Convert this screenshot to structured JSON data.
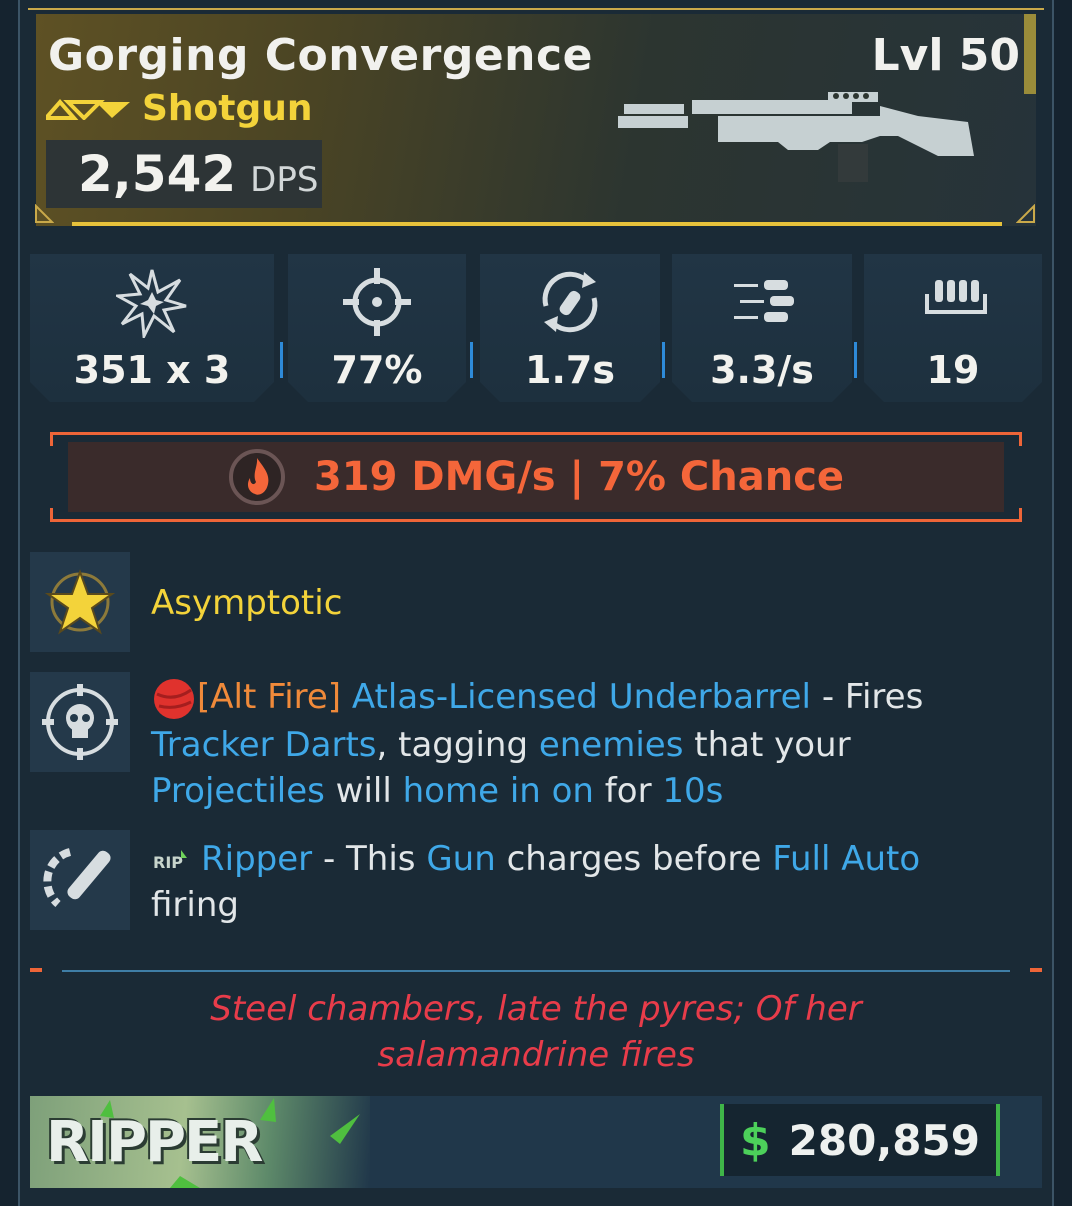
{
  "item": {
    "name": "Gorging Convergence",
    "level": "Lvl 50",
    "type": "Shotgun",
    "dps_value": "2,542",
    "dps_unit": "DPS",
    "rarity_icon": "rarity-chevrons-icon",
    "gun_icon": "shotgun-silhouette-icon"
  },
  "stats": [
    {
      "icon": "damage-burst-icon",
      "value": "351 x 3"
    },
    {
      "icon": "crosshair-icon",
      "value": "77%"
    },
    {
      "icon": "reload-icon",
      "value": "1.7s"
    },
    {
      "icon": "fire-rate-icon",
      "value": "3.3/s"
    },
    {
      "icon": "magazine-icon",
      "value": "19"
    }
  ],
  "element": {
    "icon": "fire-icon",
    "text": "319 DMG/s | 7% Chance"
  },
  "perks": [
    {
      "icon": "star-emblem-icon",
      "name": "Asymptotic"
    },
    {
      "icon": "skull-target-icon",
      "tag": "[Alt Fire]",
      "name": "Atlas-Licensed Underbarrel",
      "sep": " - Fires ",
      "t1": "Tracker Darts",
      "t2": ", tagging ",
      "t3": "enemies",
      "t4": " that your",
      "t5": "Projectiles",
      "t6": " will ",
      "t7": "home in on",
      "t8": " for ",
      "t9": "10s"
    },
    {
      "icon": "ripper-bullet-icon",
      "name": "Ripper",
      "t1": " - This ",
      "t2": "Gun",
      "t3": " charges before ",
      "t4": "Full Auto",
      "t5": "firing"
    }
  ],
  "flavor": {
    "line1": "Steel chambers, late the pyres; Of her",
    "line2": "salamandrine fires"
  },
  "footer": {
    "manufacturer": "RIPPER",
    "currency_symbol": "$",
    "price": "280,859"
  },
  "colors": {
    "rarity": "#f3d33a",
    "element": "#f4663a",
    "highlight": "#3fa8e8",
    "flavor": "#e83c4a",
    "price_accent": "#3fb548"
  }
}
